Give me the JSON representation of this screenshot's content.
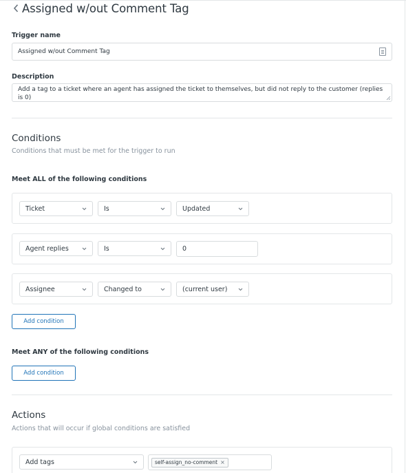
{
  "page": {
    "title": "Assigned w/out Comment Tag"
  },
  "trigger": {
    "name_label": "Trigger name",
    "name_value": "Assigned w/out Comment Tag",
    "description_label": "Description",
    "description_value": "Add a tag to a ticket where an agent has assigned the ticket to themselves, but did not reply to the customer (replies is 0)"
  },
  "conditions": {
    "heading": "Conditions",
    "subtext": "Conditions that must be met for the trigger to run",
    "all_label": "Meet ALL of the following conditions",
    "all": [
      {
        "field": "Ticket",
        "operator": "Is",
        "value": "Updated"
      },
      {
        "field": "Agent replies",
        "operator": "Is",
        "value": "0"
      },
      {
        "field": "Assignee",
        "operator": "Changed to",
        "value": "(current user)"
      }
    ],
    "add_all_button": "Add condition",
    "any_label": "Meet ANY of the following conditions",
    "add_any_button": "Add condition"
  },
  "actions": {
    "heading": "Actions",
    "subtext": "Actions that will occur if global conditions are satisfied",
    "items": [
      {
        "action": "Add tags",
        "tags": [
          "self-assign_no-comment"
        ]
      }
    ]
  },
  "colors": {
    "accent": "#1f73b7",
    "text": "#2f3941",
    "muted": "#87929d",
    "border": "#d8dcde"
  }
}
